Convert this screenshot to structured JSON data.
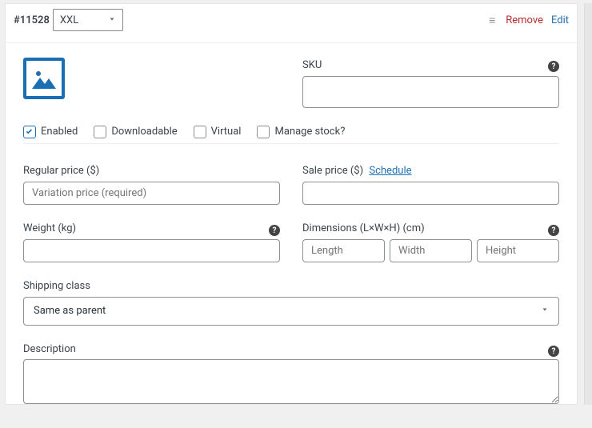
{
  "variation": {
    "id": "#11528",
    "attr_value": "XXL"
  },
  "actions": {
    "remove": "Remove",
    "edit": "Edit"
  },
  "sku": {
    "label": "SKU",
    "value": ""
  },
  "toggles": {
    "enabled": "Enabled",
    "downloadable": "Downloadable",
    "virtual": "Virtual",
    "manage_stock": "Manage stock?"
  },
  "pricing": {
    "regular_label": "Regular price ($)",
    "regular_placeholder": "Variation price (required)",
    "sale_label": "Sale price ($)",
    "schedule": "Schedule"
  },
  "weight": {
    "label": "Weight (kg)",
    "value": ""
  },
  "dimensions": {
    "label": "Dimensions (L×W×H) (cm)",
    "l": "Length",
    "w": "Width",
    "h": "Height"
  },
  "shipping": {
    "label": "Shipping class",
    "selected": "Same as parent"
  },
  "description": {
    "label": "Description"
  },
  "icons": {
    "menu": "menu-icon",
    "help": "help-icon",
    "chevron": "chevron-down-icon",
    "image": "image-placeholder-icon"
  }
}
